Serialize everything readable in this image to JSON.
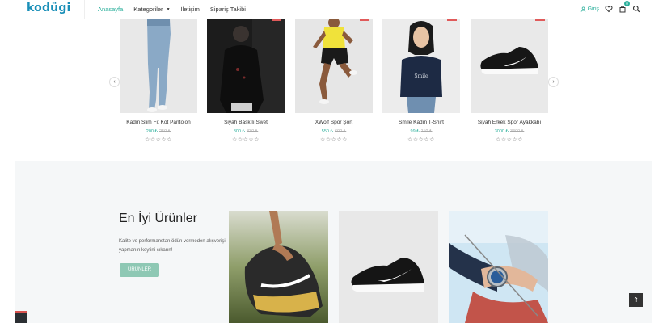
{
  "header": {
    "logo": "kodügi",
    "nav": [
      {
        "label": "Anasayfa",
        "active": true
      },
      {
        "label": "Kategoriler",
        "active": false,
        "dropdown": true
      },
      {
        "label": "İletişim",
        "active": false
      },
      {
        "label": "Sipariş Takibi",
        "active": false
      }
    ],
    "login_label": "Giriş",
    "cart_count": "0",
    "icons": [
      "user-icon",
      "heart-icon",
      "cart-icon",
      "search-icon"
    ]
  },
  "carousel": {
    "prev_icon": "chevron-left-icon",
    "next_icon": "chevron-right-icon",
    "products": [
      {
        "name": "Kadın Slim Fit Kot Pantolon",
        "price": "200 ₺",
        "old_price": "250 ₺",
        "rating": 0
      },
      {
        "name": "Siyah Baskılı Swet",
        "price": "800 ₺",
        "old_price": "830 ₺",
        "rating": 0
      },
      {
        "name": "XWolf Spor Şort",
        "price": "550 ₺",
        "old_price": "600 ₺",
        "rating": 0
      },
      {
        "name": "Smile Kadın T-Shirt",
        "price": "99 ₺",
        "old_price": "110 ₺",
        "rating": 0
      },
      {
        "name": "Siyah Erkek Spor Ayakkabı",
        "price": "3000 ₺",
        "old_price": "3400 ₺",
        "rating": 0
      }
    ]
  },
  "best": {
    "title": "En İyi Ürünler",
    "description": "Kalite ve performanstan ödün vermeden alışverişi yapmanın keyfini çıkarın!",
    "button_label": "ÜRÜNLER"
  },
  "colors": {
    "accent": "#2aaf9b",
    "logo": "#1a8fb8",
    "button": "#8ec8b4"
  }
}
